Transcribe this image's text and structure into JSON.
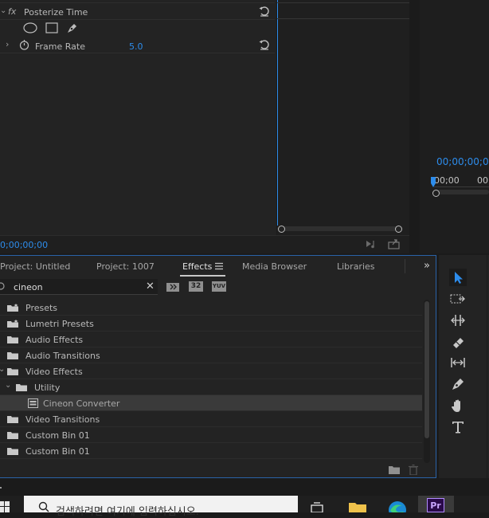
{
  "effect_controls": {
    "effect_name": "Posterize Time",
    "fx_badge": "fx",
    "param_label": "Frame Rate",
    "param_value": "5.0",
    "timecode": "0;00;00;00"
  },
  "program_monitor": {
    "timecode": "00;00;00;0",
    "ruler_start": "00;00",
    "ruler_next": "00"
  },
  "tabs": [
    {
      "label": "Project: Untitled"
    },
    {
      "label": "Project: 1007"
    },
    {
      "label": "Effects"
    },
    {
      "label": "Media Browser"
    },
    {
      "label": "Libraries"
    }
  ],
  "search": {
    "value": "cineon"
  },
  "filter_badges": [
    "32",
    "YUV"
  ],
  "effects_tree": [
    {
      "label": "Presets",
      "indent": 0
    },
    {
      "label": "Lumetri Presets",
      "indent": 0
    },
    {
      "label": "Audio Effects",
      "indent": 0
    },
    {
      "label": "Audio Transitions",
      "indent": 0
    },
    {
      "label": "Video Effects",
      "indent": 0,
      "expanded": true
    },
    {
      "label": "Utility",
      "indent": 1,
      "expanded": true
    },
    {
      "label": "Cineon Converter",
      "indent": 2,
      "selected": true
    },
    {
      "label": "Video Transitions",
      "indent": 0
    },
    {
      "label": "Custom Bin 01",
      "indent": 0
    },
    {
      "label": "Custom Bin 01",
      "indent": 0
    }
  ],
  "taskbar": {
    "search_placeholder": "검색하려면 여기에 입력하십시오.",
    "pr_label": "Pr"
  },
  "colors": {
    "accent_blue": "#2d8ceb",
    "panel": "#232323",
    "focus_border": "#2a63a8",
    "premiere_purple": "#2a0a4a"
  }
}
